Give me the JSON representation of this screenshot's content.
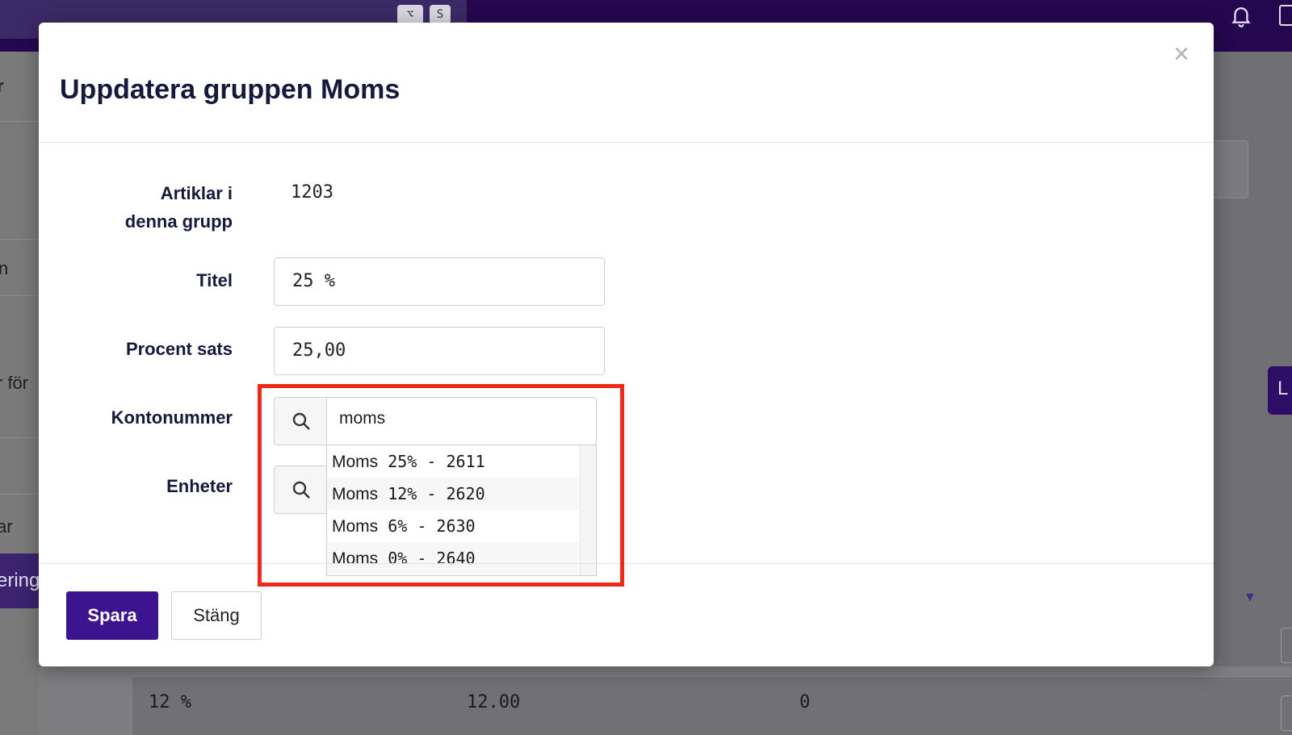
{
  "background": {
    "kbd_keys": [
      "⌥",
      "S"
    ],
    "left_texts": [
      "r",
      "n",
      "r för",
      "ar"
    ],
    "left_button_label": "ering",
    "right_button_label": "L",
    "table_row": [
      "12 %",
      "12.00",
      "0"
    ]
  },
  "modal": {
    "title": "Uppdatera gruppen Moms",
    "close_label": "×",
    "articles_label_line1": "Artiklar i",
    "articles_label_line2": "denna grupp",
    "articles_value": "1203",
    "titel_label": "Titel",
    "titel_value": "25 %",
    "procent_label": "Procent sats",
    "procent_value": "25,00",
    "konto_label": "Kontonummer",
    "konto_search_value": "moms",
    "enheter_label": "Enheter",
    "dropdown_options": [
      {
        "word": "Moms",
        "rest": " 25% - 2611"
      },
      {
        "word": "Moms",
        "rest": " 12% - 2620"
      },
      {
        "word": "Moms",
        "rest": " 6% - 2630"
      },
      {
        "word": "Moms",
        "rest": " 0% - 2640"
      }
    ],
    "save_label": "Spara",
    "close_button_label": "Stäng"
  },
  "colors": {
    "primary": "#3d148f",
    "topbar": "#25074f",
    "highlight": "#f02a1a"
  }
}
